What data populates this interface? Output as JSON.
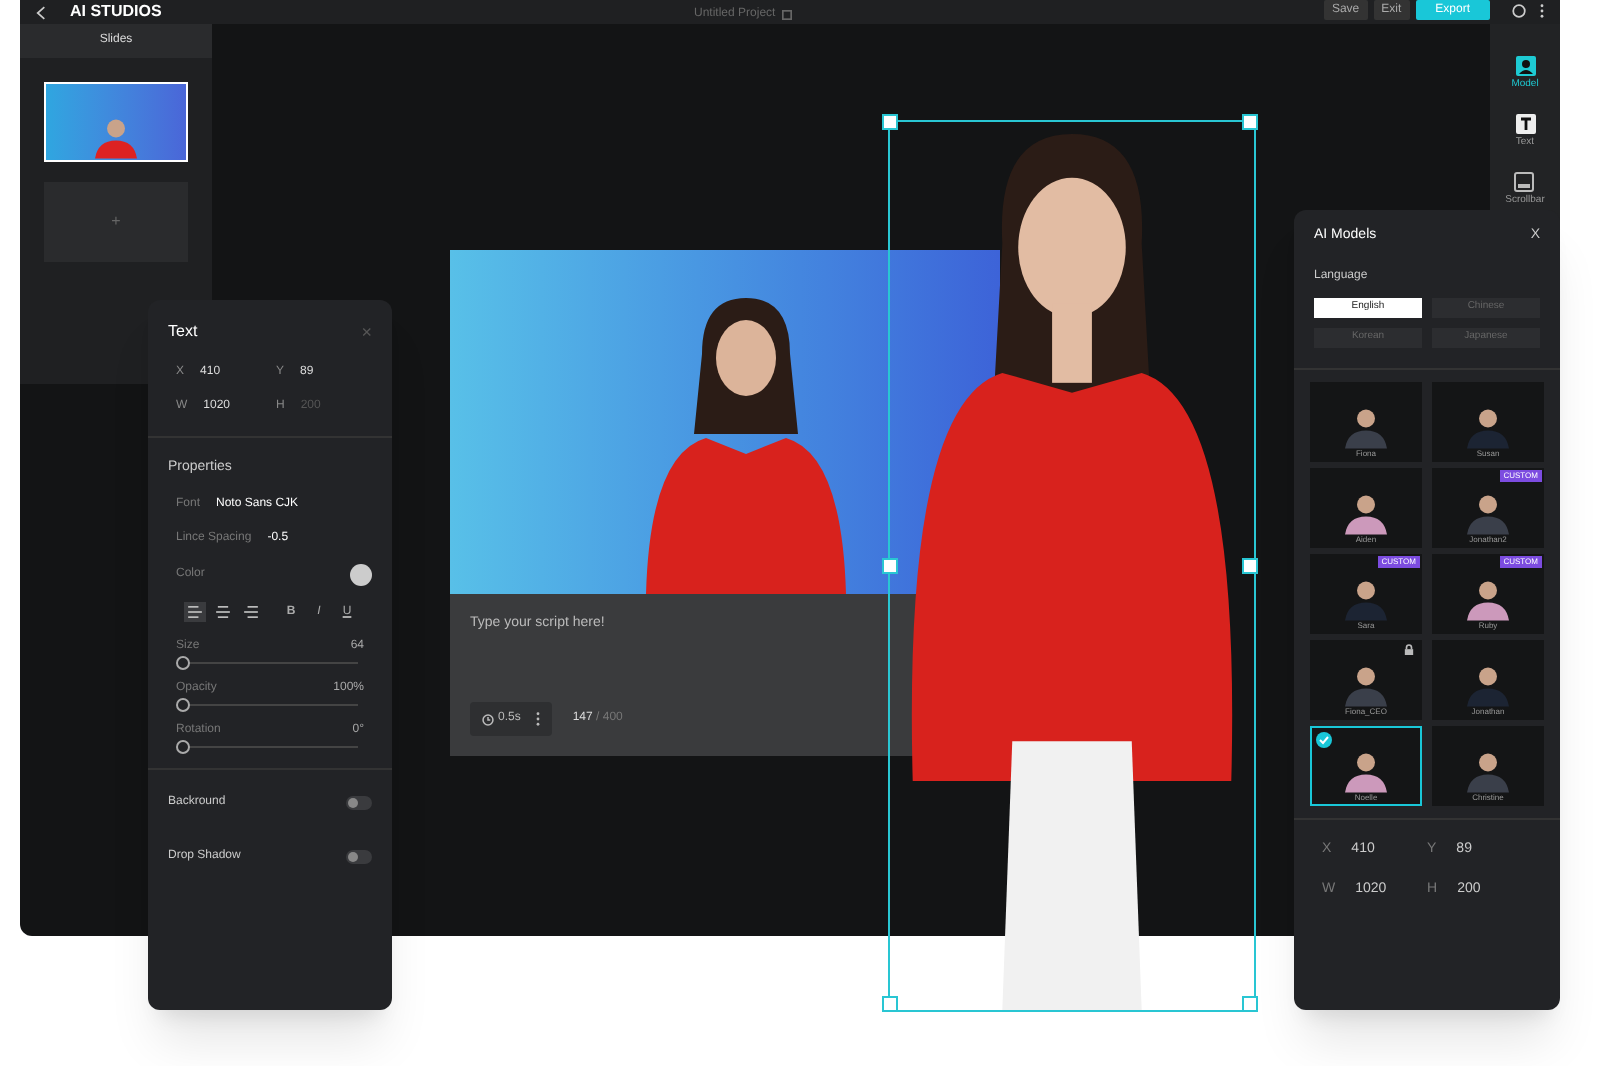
{
  "top_bar": {
    "logo": "AI STUDIOS",
    "project_title": "Untitled Project",
    "buttons": [
      {
        "label": "Save",
        "kind": "plain"
      },
      {
        "label": "Exit",
        "kind": "plain"
      },
      {
        "label": "Export",
        "kind": "primary"
      }
    ]
  },
  "slides": {
    "title": "Slides",
    "items": [
      {
        "kind": "thumbnail",
        "selected": true
      },
      {
        "kind": "add",
        "label": "+",
        "selected": false
      }
    ]
  },
  "toolbar": [
    {
      "label": "Model",
      "kind": "person",
      "selected": true
    },
    {
      "label": "Text",
      "kind": "text",
      "selected": false
    },
    {
      "label": "Scrollbar",
      "kind": "screen",
      "selected": false
    }
  ],
  "text_panel": {
    "title": "Text",
    "close": "×",
    "fields": [
      {
        "label": "X",
        "value": "410",
        "disabled": false
      },
      {
        "label": "Y",
        "value": "89",
        "disabled": false
      },
      {
        "label": "W",
        "value": "1020",
        "disabled": false
      },
      {
        "label": "H",
        "value": "200",
        "disabled": true
      }
    ],
    "properties_title": "Properties",
    "font_label": "Font",
    "font_value": "Noto Sans CJK",
    "spacing_label": "Lince Spacing",
    "spacing_value": "-0.5",
    "color_label": "Color",
    "align": [
      {
        "kind": "left",
        "selected": true
      },
      {
        "kind": "center",
        "selected": false
      },
      {
        "kind": "right",
        "selected": false
      },
      {
        "kind": "bold",
        "label": "B",
        "selected": false
      },
      {
        "kind": "italic",
        "label": "I",
        "selected": false
      },
      {
        "kind": "underline",
        "label": "U",
        "selected": false
      }
    ],
    "sliders": [
      {
        "label": "Size",
        "reading": "64",
        "level": 0
      },
      {
        "label": "Opacity",
        "reading": "100%",
        "level": 0
      },
      {
        "label": "Rotation",
        "reading": "0°",
        "level": 0
      }
    ],
    "toggles": [
      {
        "label": "Backround",
        "on": false
      },
      {
        "label": "Drop Shadow",
        "on": false
      }
    ]
  },
  "canvas": {
    "script_placeholder": "Type your script here!",
    "duration": "0.5s",
    "char_count": "147",
    "char_limit": "/ 400"
  },
  "models_panel": {
    "title": "AI Models",
    "close": "X",
    "language_title": "Language",
    "languages": [
      {
        "label": "English",
        "selected": true
      },
      {
        "label": "Chinese",
        "selected": false
      },
      {
        "label": "Korean",
        "selected": false
      },
      {
        "label": "Japanese",
        "selected": false
      }
    ],
    "models": [
      {
        "name": "Fiona",
        "locked": false,
        "selected": false
      },
      {
        "name": "Susan",
        "locked": false,
        "selected": false
      },
      {
        "name": "Aiden",
        "locked": false,
        "selected": false
      },
      {
        "name": "Jonathan2",
        "badge": "CUSTOM",
        "locked": false,
        "selected": false
      },
      {
        "name": "Sara",
        "badge": "CUSTOM",
        "locked": false,
        "selected": false
      },
      {
        "name": "Ruby",
        "badge": "CUSTOM",
        "locked": false,
        "selected": false
      },
      {
        "name": "Fiona_CEO",
        "locked": true,
        "selected": false
      },
      {
        "name": "Jonathan",
        "locked": false,
        "selected": false
      },
      {
        "name": "Noelle",
        "locked": false,
        "selected": true
      },
      {
        "name": "Christine",
        "locked": false,
        "selected": false
      }
    ],
    "fields": [
      {
        "label": "X",
        "value": "410"
      },
      {
        "label": "Y",
        "value": "89"
      },
      {
        "label": "W",
        "value": "1020"
      },
      {
        "label": "H",
        "value": "200"
      }
    ]
  }
}
